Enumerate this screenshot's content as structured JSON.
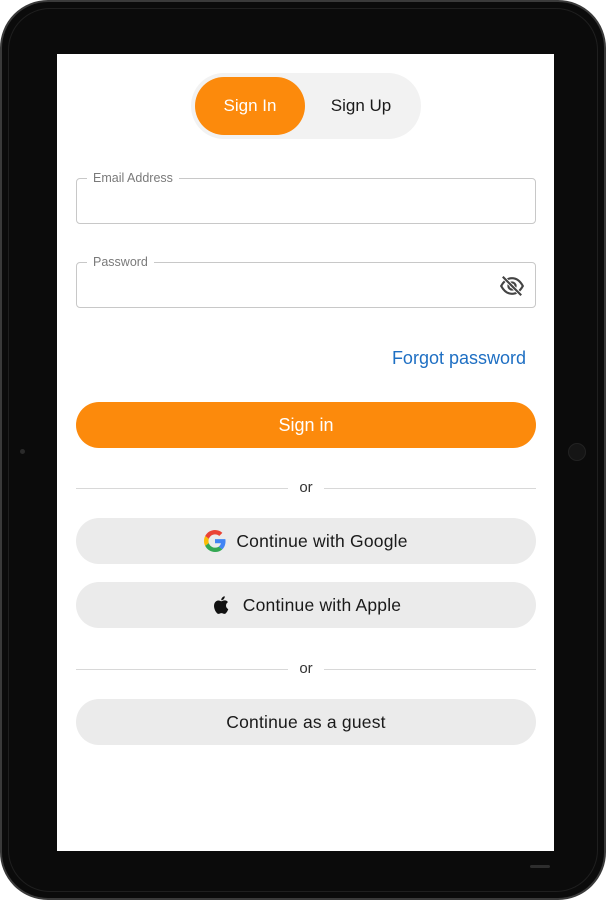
{
  "tabs": {
    "sign_in": "Sign In",
    "sign_up": "Sign Up",
    "active": "Sign In"
  },
  "email": {
    "label": "Email Address",
    "value": ""
  },
  "password": {
    "label": "Password",
    "value": "",
    "visibility_icon": "eye-off-icon"
  },
  "forgot_password": "Forgot password",
  "sign_in_button": "Sign in",
  "divider_text_1": "or",
  "google_button": {
    "label": "Continue with Google",
    "icon": "google-icon"
  },
  "apple_button": {
    "label": "Continue with Apple",
    "icon": "apple-icon"
  },
  "divider_text_2": "or",
  "guest_button": "Continue as a guest",
  "colors": {
    "accent": "#fc8a0c",
    "link": "#1e6fc3",
    "secondary_button": "#ebebeb"
  }
}
